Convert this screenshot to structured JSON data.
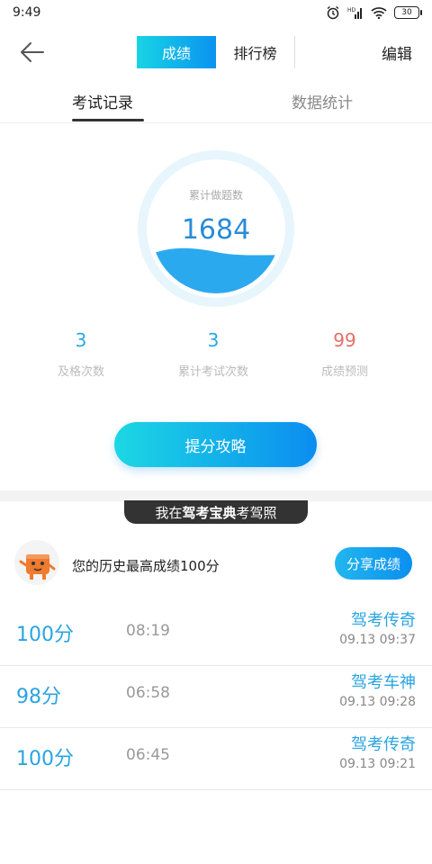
{
  "status_bar": {
    "time": "9:49",
    "battery": "30"
  },
  "header": {
    "tabs": [
      {
        "label": "成绩",
        "active": true
      },
      {
        "label": "排行榜",
        "active": false
      }
    ],
    "edit_label": "编辑"
  },
  "subtabs": [
    {
      "label": "考试记录",
      "active": true
    },
    {
      "label": "数据统计",
      "active": false
    }
  ],
  "gauge": {
    "label": "累计做题数",
    "value": "1684"
  },
  "stats": [
    {
      "value": "3",
      "label": "及格次数",
      "color": "#29a7e6"
    },
    {
      "value": "3",
      "label": "累计考试次数",
      "color": "#29a7e6"
    },
    {
      "value": "99",
      "label": "成绩预测",
      "color": "#e27067"
    }
  ],
  "boost_button": {
    "label": "提分攻略"
  },
  "banner": {
    "prefix": "我在",
    "brand": "驾考宝典",
    "suffix": "考驾照"
  },
  "best": {
    "text": "您的历史最高成绩100分",
    "share_label": "分享成绩"
  },
  "records": [
    {
      "score": "100分",
      "duration": "08:19",
      "title": "驾考传奇",
      "date": "09.13  09:37"
    },
    {
      "score": "98分",
      "duration": "06:58",
      "title": "驾考车神",
      "date": "09.13  09:28"
    },
    {
      "score": "100分",
      "duration": "06:45",
      "title": "驾考传奇",
      "date": "09.13  09:21"
    }
  ],
  "colors": {
    "accent": "#0b93f0",
    "accent_light": "#18d4e4",
    "danger": "#e27067"
  }
}
